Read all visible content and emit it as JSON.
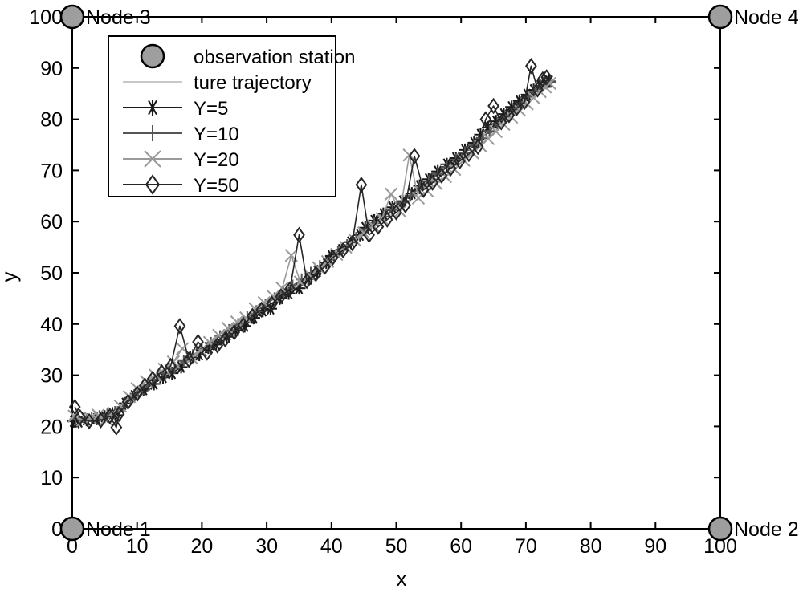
{
  "chart_data": {
    "type": "line",
    "title": "",
    "xlabel": "x",
    "ylabel": "y",
    "xlim": [
      0,
      100
    ],
    "ylim": [
      0,
      100
    ],
    "xticks": [
      0,
      10,
      20,
      30,
      40,
      50,
      60,
      70,
      80,
      90,
      100
    ],
    "yticks": [
      0,
      10,
      20,
      30,
      40,
      50,
      60,
      70,
      80,
      90,
      100
    ],
    "grid": false,
    "legend_position": "upper-left",
    "legend": [
      {
        "label": "observation station",
        "marker": "filled-circle",
        "color": "#9e9e9e",
        "line": "none"
      },
      {
        "label": "ture trajectory",
        "marker": "none",
        "color": "#c8c8c8",
        "line": "solid"
      },
      {
        "label": "Υ=5",
        "marker": "asterisk",
        "color": "#1a1a1a",
        "line": "solid"
      },
      {
        "label": "Υ=10",
        "marker": "plus",
        "color": "#555555",
        "line": "solid"
      },
      {
        "label": "Υ=20",
        "marker": "x",
        "color": "#9a9a9a",
        "line": "solid"
      },
      {
        "label": "Υ=50",
        "marker": "diamond",
        "color": "#262626",
        "line": "solid"
      }
    ],
    "annotations": [
      {
        "text": "Node 1",
        "x": 0,
        "y": 0
      },
      {
        "text": "Node 2",
        "x": 100,
        "y": 0
      },
      {
        "text": "Node 3",
        "x": 0,
        "y": 100
      },
      {
        "text": "Node 4",
        "x": 100,
        "y": 100
      }
    ],
    "observation_stations": [
      {
        "name": "Node 1",
        "x": 0,
        "y": 0
      },
      {
        "name": "Node 2",
        "x": 100,
        "y": 0
      },
      {
        "name": "Node 3",
        "x": 0,
        "y": 100
      },
      {
        "name": "Node 4",
        "x": 100,
        "y": 100
      }
    ],
    "series": [
      {
        "name": "ture trajectory",
        "color": "#c8c8c8",
        "marker": "none",
        "x": [
          0.4,
          1.4,
          2.4,
          3.4,
          4.4,
          5.4,
          6.4,
          7.6,
          9.0,
          10.4,
          11.8,
          13.2,
          14.6,
          16.0,
          17.4,
          18.8,
          20.2,
          21.6,
          23.0,
          24.4,
          25.8,
          27.2,
          28.6,
          30.0,
          31.4,
          32.8,
          34.2,
          35.6,
          37.0,
          38.4,
          39.8,
          41.2,
          42.6,
          44.0,
          45.4,
          46.8,
          48.2,
          49.6,
          51.0,
          52.4,
          53.8,
          55.2,
          56.6,
          58.0,
          59.4,
          60.8,
          62.2,
          63.4,
          64.6,
          65.8,
          67.0,
          68.2,
          69.3,
          70.4,
          71.4,
          72.3,
          73.0,
          73.6
        ],
        "y": [
          21.6,
          21.6,
          21.7,
          21.8,
          21.9,
          22.0,
          22.3,
          23.8,
          25.3,
          26.6,
          27.8,
          29.0,
          30.1,
          31.2,
          32.4,
          33.6,
          34.8,
          36.0,
          37.2,
          38.5,
          39.7,
          41.0,
          42.2,
          43.4,
          44.6,
          45.8,
          47.0,
          48.3,
          49.5,
          50.8,
          52.0,
          53.4,
          54.8,
          56.3,
          57.8,
          59.2,
          60.5,
          61.8,
          63.2,
          64.6,
          66.0,
          67.4,
          68.8,
          70.2,
          71.6,
          73.0,
          74.4,
          75.8,
          77.2,
          78.6,
          80.0,
          81.4,
          82.6,
          83.8,
          84.9,
          85.9,
          86.6,
          87.1
        ]
      },
      {
        "name": "Υ=5",
        "color": "#1a1a1a",
        "marker": "asterisk",
        "x": [
          0.2,
          1.0,
          2.2,
          3.8,
          5.0,
          6.2,
          7.0,
          8.2,
          9.6,
          11.0,
          12.6,
          14.0,
          15.4,
          16.8,
          18.2,
          19.6,
          21.0,
          22.2,
          23.8,
          25.2,
          26.6,
          28.0,
          29.4,
          30.6,
          32.0,
          33.4,
          35.0,
          36.4,
          37.8,
          39.2,
          40.0,
          41.6,
          43.0,
          44.4,
          45.2,
          46.6,
          48.0,
          49.4,
          51.0,
          52.4,
          53.6,
          55.0,
          56.4,
          57.8,
          59.2,
          60.6,
          62.0,
          63.0,
          64.2,
          65.4,
          66.6,
          67.8,
          69.0,
          70.2,
          71.2,
          72.2,
          73.0,
          73.6
        ],
        "y": [
          21.0,
          20.9,
          21.3,
          21.5,
          21.9,
          22.5,
          22.2,
          24.5,
          26.0,
          27.2,
          28.3,
          29.6,
          30.4,
          31.6,
          33.5,
          34.0,
          35.4,
          36.0,
          37.5,
          38.8,
          39.6,
          41.2,
          42.6,
          43.0,
          45.0,
          46.0,
          47.0,
          48.8,
          50.3,
          52.0,
          53.3,
          54.5,
          56.0,
          57.4,
          58.8,
          60.2,
          61.5,
          62.8,
          64.0,
          65.5,
          67.0,
          68.3,
          69.8,
          71.2,
          72.4,
          74.0,
          75.4,
          77.0,
          78.4,
          79.6,
          81.0,
          82.4,
          83.6,
          84.8,
          85.7,
          86.5,
          87.2,
          87.4
        ]
      },
      {
        "name": "Υ=10",
        "color": "#555555",
        "marker": "plus",
        "x": [
          0.5,
          1.8,
          3.0,
          4.2,
          5.4,
          6.6,
          7.8,
          9.0,
          10.2,
          11.6,
          13.0,
          14.4,
          15.8,
          17.2,
          18.6,
          20.0,
          21.4,
          22.8,
          24.2,
          25.6,
          27.0,
          28.4,
          29.8,
          31.2,
          32.6,
          34.0,
          35.4,
          36.8,
          38.2,
          39.6,
          41.0,
          42.4,
          43.8,
          45.2,
          46.6,
          48.0,
          49.4,
          50.8,
          52.2,
          53.6,
          55.0,
          56.4,
          57.8,
          59.2,
          60.6,
          62.0,
          63.2,
          64.4,
          65.6,
          66.8,
          68.0,
          69.2,
          70.4,
          71.4,
          72.4,
          73.2,
          73.8
        ],
        "y": [
          21.4,
          21.5,
          21.7,
          22.0,
          22.3,
          22.8,
          23.8,
          25.4,
          26.8,
          27.9,
          29.2,
          30.4,
          31.4,
          32.8,
          33.9,
          35.2,
          36.3,
          37.6,
          38.8,
          40.0,
          41.3,
          42.5,
          43.8,
          45.0,
          46.2,
          47.5,
          48.7,
          50.0,
          51.3,
          52.6,
          54.0,
          55.4,
          56.8,
          58.3,
          59.7,
          61.0,
          62.3,
          63.7,
          65.1,
          66.5,
          67.9,
          69.3,
          70.7,
          72.1,
          73.5,
          74.9,
          76.3,
          77.7,
          79.1,
          80.5,
          81.9,
          83.2,
          84.4,
          85.4,
          86.3,
          87.0,
          87.3
        ]
      },
      {
        "name": "Υ=20",
        "color": "#9a9a9a",
        "marker": "x",
        "x": [
          0.3,
          1.6,
          2.8,
          4.0,
          5.2,
          6.4,
          7.4,
          8.8,
          10.0,
          11.4,
          12.8,
          14.2,
          15.6,
          17.0,
          18.4,
          19.8,
          21.2,
          22.6,
          24.0,
          25.4,
          26.8,
          28.2,
          29.6,
          31.0,
          32.4,
          33.8,
          35.2,
          36.6,
          38.0,
          39.4,
          40.8,
          42.2,
          43.6,
          45.0,
          46.4,
          47.8,
          49.2,
          50.6,
          52.0,
          53.4,
          54.8,
          56.2,
          57.6,
          59.0,
          60.4,
          61.8,
          63.0,
          64.2,
          65.4,
          66.6,
          67.8,
          69.0,
          70.2,
          71.2,
          72.2,
          73.0,
          73.7
        ],
        "y": [
          22.0,
          21.2,
          21.6,
          22.2,
          21.4,
          22.6,
          24.0,
          25.8,
          27.4,
          28.8,
          30.0,
          31.2,
          32.6,
          35.2,
          33.4,
          34.8,
          36.4,
          37.8,
          39.2,
          40.4,
          41.2,
          43.0,
          44.2,
          45.4,
          47.0,
          53.4,
          48.2,
          49.6,
          51.0,
          52.2,
          53.6,
          55.0,
          56.4,
          57.8,
          59.2,
          60.6,
          65.4,
          62.0,
          73.0,
          64.6,
          66.0,
          67.4,
          68.8,
          70.2,
          72.0,
          73.4,
          74.8,
          76.2,
          77.6,
          79.0,
          80.4,
          81.8,
          83.0,
          84.2,
          85.4,
          86.3,
          87.0
        ]
      },
      {
        "name": "Υ=50",
        "color": "#262626",
        "marker": "diamond",
        "x": [
          0.4,
          1.2,
          2.6,
          4.4,
          5.8,
          6.8,
          7.2,
          8.6,
          10.0,
          11.2,
          12.4,
          13.8,
          15.2,
          16.6,
          18.0,
          19.4,
          20.8,
          22.4,
          23.6,
          25.0,
          26.4,
          27.8,
          29.2,
          30.8,
          32.2,
          33.6,
          35.0,
          36.2,
          37.6,
          39.0,
          40.2,
          41.8,
          43.2,
          44.6,
          45.8,
          47.2,
          48.6,
          50.0,
          51.4,
          52.8,
          54.2,
          55.6,
          57.0,
          58.4,
          59.8,
          61.2,
          62.6,
          63.8,
          65.0,
          66.2,
          67.4,
          68.6,
          69.8,
          70.8,
          71.8,
          72.6,
          73.2
        ],
        "y": [
          23.8,
          21.8,
          21.0,
          21.2,
          22.0,
          19.8,
          22.4,
          24.8,
          26.4,
          28.0,
          29.3,
          30.6,
          31.8,
          39.6,
          33.0,
          36.5,
          34.4,
          35.8,
          37.0,
          38.4,
          39.8,
          41.6,
          42.8,
          44.0,
          45.4,
          46.8,
          57.4,
          48.4,
          49.8,
          51.2,
          53.0,
          54.4,
          55.8,
          67.2,
          57.4,
          59.0,
          60.4,
          61.8,
          63.2,
          72.8,
          66.2,
          67.6,
          69.0,
          70.4,
          71.8,
          73.2,
          74.6,
          80.0,
          82.6,
          79.4,
          80.8,
          82.2,
          83.4,
          90.4,
          85.8,
          87.8,
          88.2
        ]
      }
    ]
  }
}
